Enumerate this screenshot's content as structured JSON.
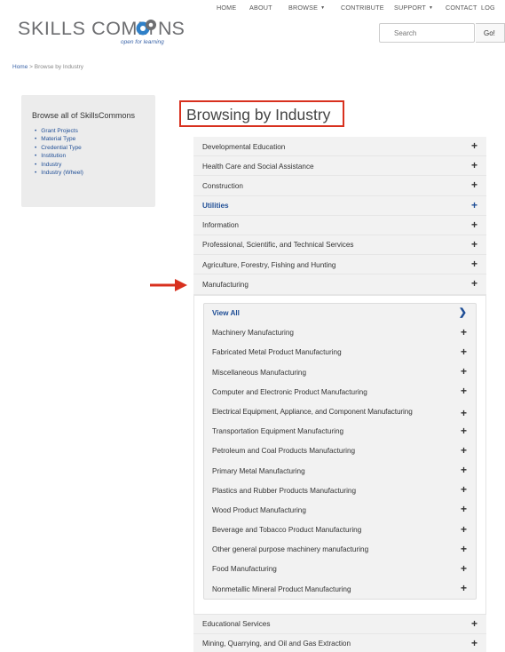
{
  "topnav": {
    "home": "HOME",
    "about": "ABOUT",
    "browse": "BROWSE",
    "contribute": "CONTRIBUTE",
    "support": "SUPPORT",
    "contact": "CONTACT",
    "login": "LOG"
  },
  "logo": {
    "text_a": "SKILLS COMM",
    "text_b": "NS",
    "tagline": "open for learning"
  },
  "search": {
    "placeholder": "Search",
    "button": "Go!"
  },
  "breadcrumb": {
    "home": "Home",
    "separator": ">",
    "current": "Browse by Industry"
  },
  "sidebar": {
    "title": "Browse all of SkillsCommons",
    "items": [
      "Grant Projects",
      "Material Type",
      "Credential Type",
      "Institution",
      "Industry",
      "Industry (Wheel)"
    ]
  },
  "page_title": "Browsing by Industry",
  "industries_top": [
    "Developmental Education",
    "Health Care and Social Assistance",
    "Construction",
    "Utilities",
    "Information",
    "Professional, Scientific, and Technical Services",
    "Agriculture, Forestry, Fishing and Hunting",
    "Manufacturing"
  ],
  "manufacturing_sub": {
    "view_all": "View All",
    "items": [
      "Machinery Manufacturing",
      "Fabricated Metal Product Manufacturing",
      "Miscellaneous Manufacturing",
      "Computer and Electronic Product Manufacturing",
      "Electrical Equipment, Appliance, and Component Manufacturing",
      "Transportation Equipment Manufacturing",
      "Petroleum and Coal Products Manufacturing",
      "Primary Metal Manufacturing",
      "Plastics and Rubber Products Manufacturing",
      "Wood Product Manufacturing",
      "Beverage and Tobacco Product Manufacturing",
      "Other general purpose machinery manufacturing",
      "Food Manufacturing",
      "Nonmetallic Mineral Product Manufacturing"
    ]
  },
  "industries_bottom": [
    "Educational Services",
    "Mining, Quarrying, and Oil and Gas Extraction"
  ],
  "icons": {
    "expand": "plus-icon",
    "view_all": "chevron-right-icon",
    "annotation": "red-arrow-icon"
  },
  "colors": {
    "link_blue": "#1f4e96",
    "highlight_red": "#d8301e",
    "row_gray": "#f2f2f2"
  }
}
